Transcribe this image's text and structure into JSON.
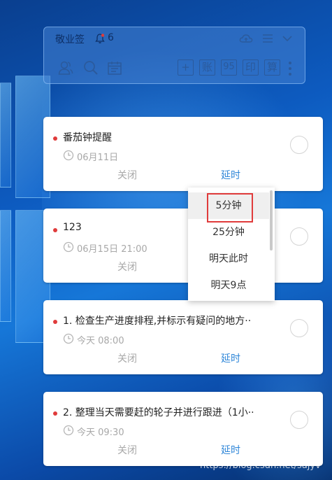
{
  "app": {
    "title": "敬业签",
    "notification_count": "6"
  },
  "toolbar": {
    "box_buttons": [
      "+",
      "账",
      "95",
      "印",
      "算"
    ]
  },
  "cards": [
    {
      "title": "番茄钟提醒",
      "time": "06月11日",
      "close_label": "关闭",
      "delay_label": "延时"
    },
    {
      "title": "123",
      "time": "06月15日  21:00",
      "close_label": "关闭"
    },
    {
      "title": "1.  检查生产进度排程,并标示有疑问的地方··",
      "time": "今天  08:00",
      "close_label": "关闭",
      "delay_label": "延时"
    },
    {
      "title": "2.  整理当天需要赶的轮子并进行跟进（1小··",
      "time": "今天  09:30",
      "close_label": "关闭",
      "delay_label": "延时"
    }
  ],
  "delay_menu": {
    "options": [
      "5分钟",
      "25分钟",
      "明天此时",
      "明天9点"
    ],
    "selected": "5分钟"
  },
  "watermark": "https://blog.csdn.net/sajyv",
  "colors": {
    "accent_blue": "#2e86d8",
    "reminder_dot": "#e03b3b",
    "muted_text": "#a8a8a8",
    "selection_border": "#e03b3b"
  },
  "icons": {
    "notification": "bell-icon",
    "cloud": "cloud-icon",
    "menu": "hamburger-menu-icon",
    "collapse": "chevron-down-icon",
    "contacts": "contacts-icon",
    "search": "search-icon",
    "calendar": "calendar-icon",
    "more": "more-vertical-icon",
    "clock": "clock-icon"
  }
}
